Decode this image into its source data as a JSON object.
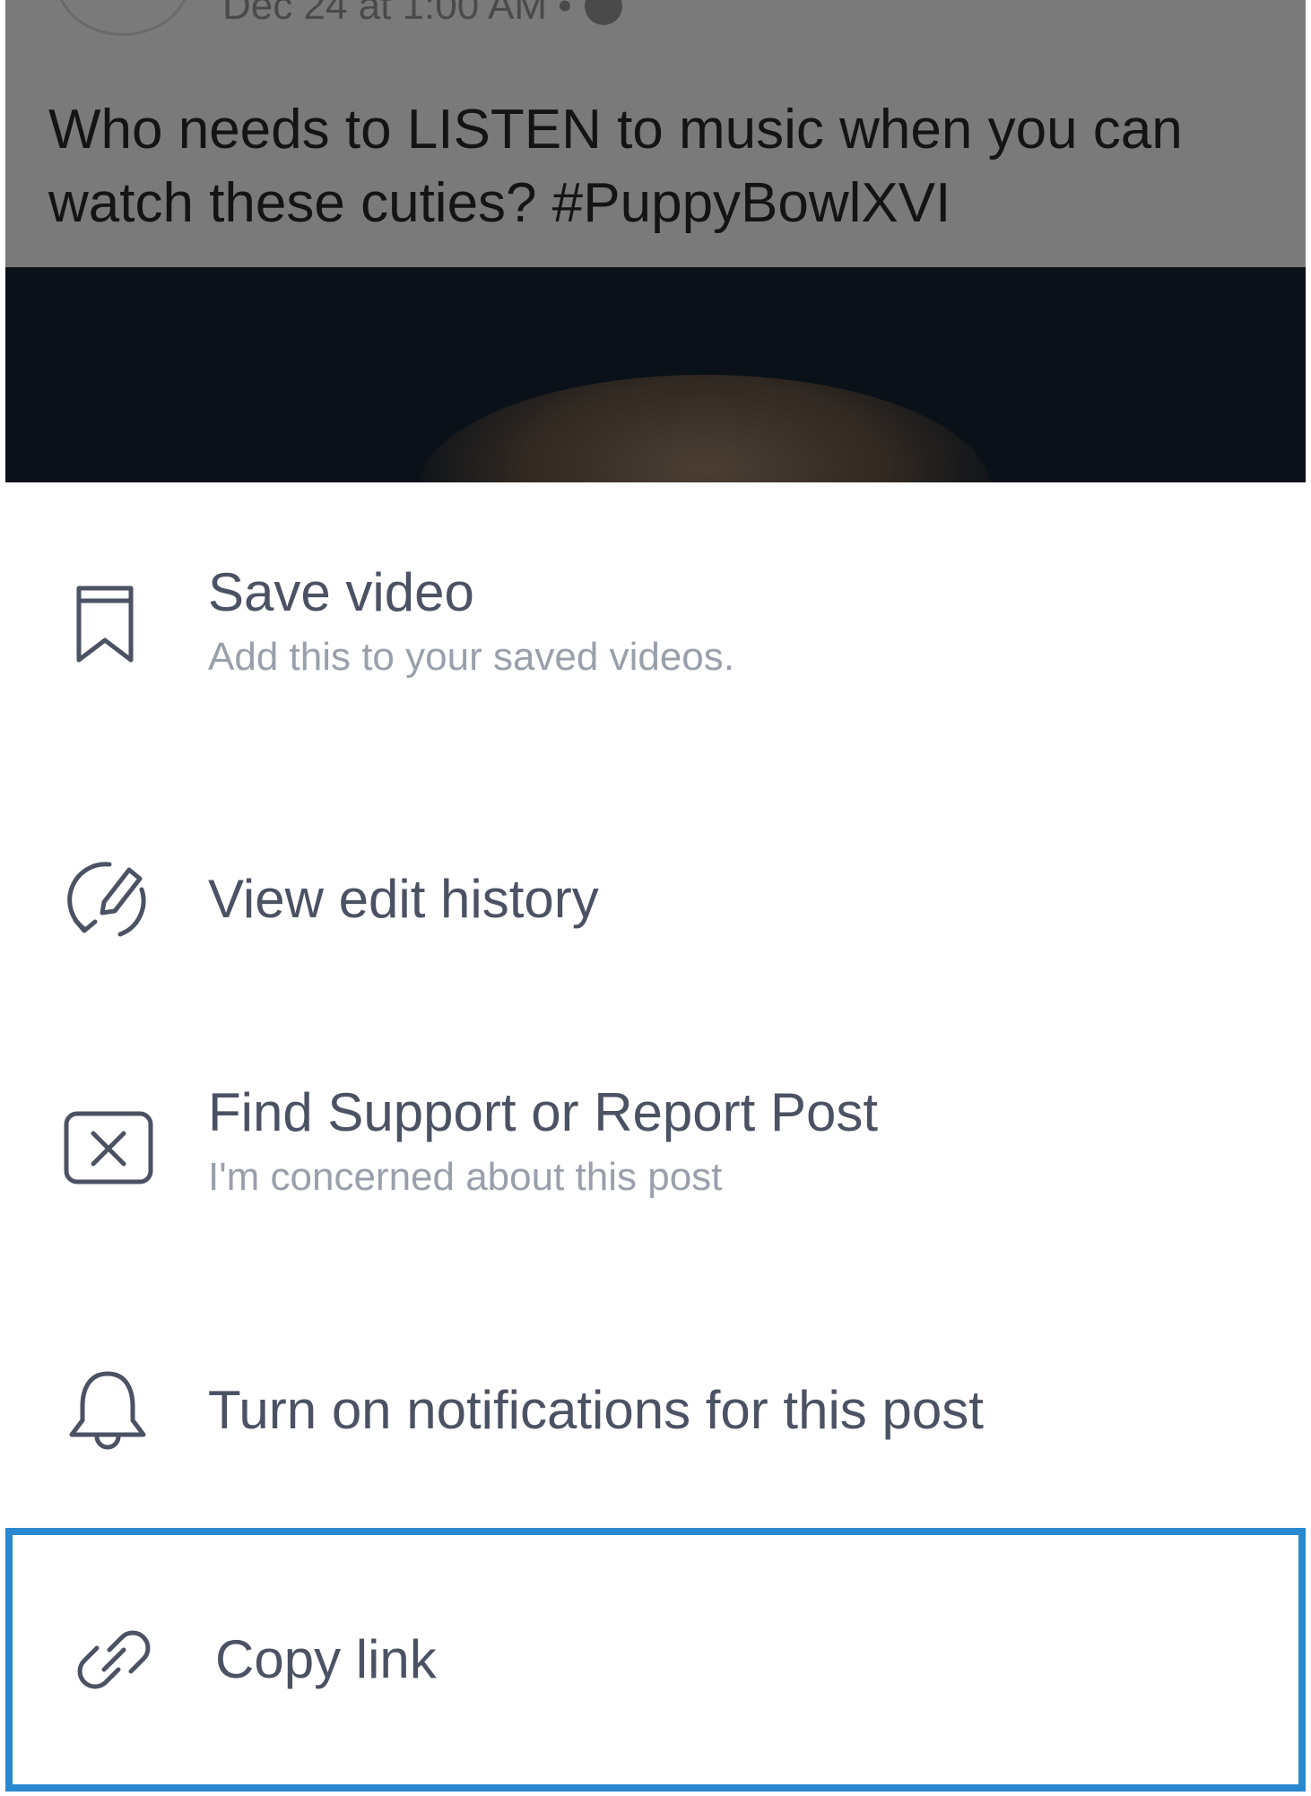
{
  "post": {
    "timestamp": "Dec 24 at 1:00 AM •",
    "text": "Who needs to LISTEN to music when you can watch these cuties? ",
    "hashtag": "#PuppyBowlXVI"
  },
  "menu": {
    "items": [
      {
        "label": "Save video",
        "subtitle": "Add this to your saved videos.",
        "icon": "bookmark-icon"
      },
      {
        "label": "View edit history",
        "icon": "edit-history-icon"
      },
      {
        "label": "Find Support or Report Post",
        "subtitle": "I'm concerned about this post",
        "icon": "report-icon"
      },
      {
        "label": "Turn on notifications for this post",
        "icon": "bell-icon"
      },
      {
        "label": "Copy link",
        "icon": "link-icon",
        "highlighted": true
      }
    ]
  },
  "colors": {
    "highlight_border": "#2a88d0",
    "label": "#4b5263",
    "subtitle": "#99a0ab",
    "overlay": "#7a7a7a"
  }
}
